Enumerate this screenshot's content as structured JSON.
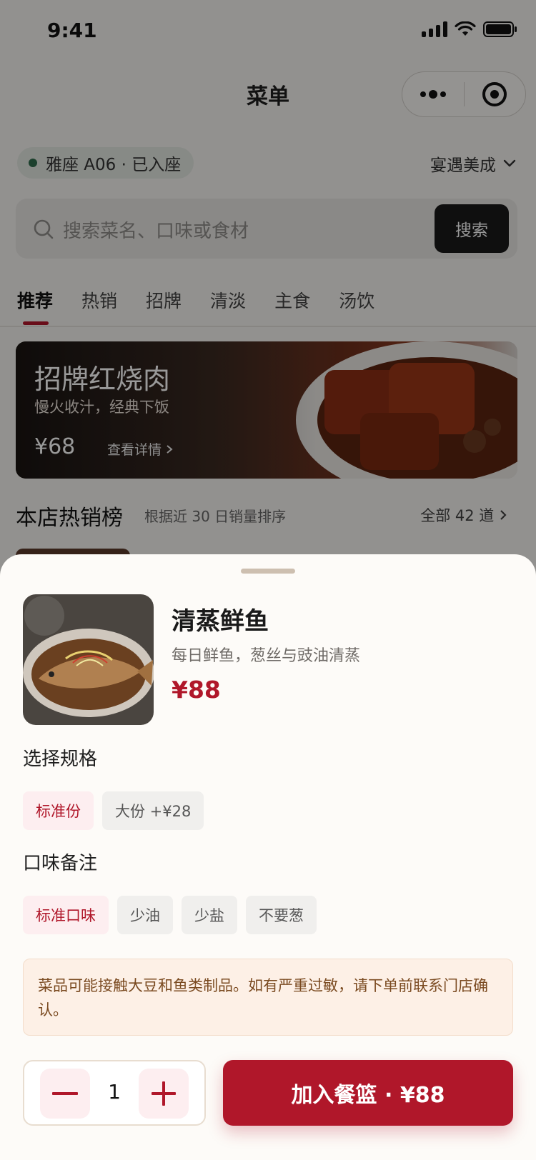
{
  "status_bar": {
    "time": "9:41"
  },
  "nav": {
    "title": "菜单"
  },
  "table": {
    "label": "雅座 A06 · 已入座"
  },
  "store": {
    "name": "宴遇美成"
  },
  "search": {
    "placeholder": "搜索菜名、口味或食材",
    "button": "搜索"
  },
  "category_tabs": [
    {
      "label": "推荐",
      "active": true
    },
    {
      "label": "热销"
    },
    {
      "label": "招牌"
    },
    {
      "label": "清淡"
    },
    {
      "label": "主食"
    },
    {
      "label": "汤饮"
    }
  ],
  "banner": {
    "title": "招牌红烧肉",
    "subtitle": "慢火收汁，经典下饭",
    "price": "¥68",
    "link": "查看详情"
  },
  "hot_list": {
    "title": "本店热销榜",
    "subtitle": "根据近 30 日销量排序",
    "all": "全部 42 道"
  },
  "sheet": {
    "dish": {
      "name": "清蒸鲜鱼",
      "desc": "每日鲜鱼，葱丝与豉油清蒸",
      "price": "¥88"
    },
    "spec": {
      "label": "选择规格",
      "options": [
        {
          "label": "标准份",
          "selected": true
        },
        {
          "label": "大份 +¥28",
          "selected": false
        }
      ]
    },
    "taste": {
      "label": "口味备注",
      "options": [
        {
          "label": "标准口味",
          "selected": true
        },
        {
          "label": "少油",
          "selected": false
        },
        {
          "label": "少盐",
          "selected": false
        },
        {
          "label": "不要葱",
          "selected": false
        }
      ]
    },
    "notice": "菜品可能接触大豆和鱼类制品。如有严重过敏，请下单前联系门店确认。",
    "quantity": "1",
    "add_button": "加入餐篮 · ¥88"
  },
  "colors": {
    "accent": "#b0172a",
    "accent_soft": "#fdeef0",
    "notice_bg": "#fdf0e6",
    "notice_text": "#7a4a20",
    "seated_dot": "#2f6b4b"
  }
}
